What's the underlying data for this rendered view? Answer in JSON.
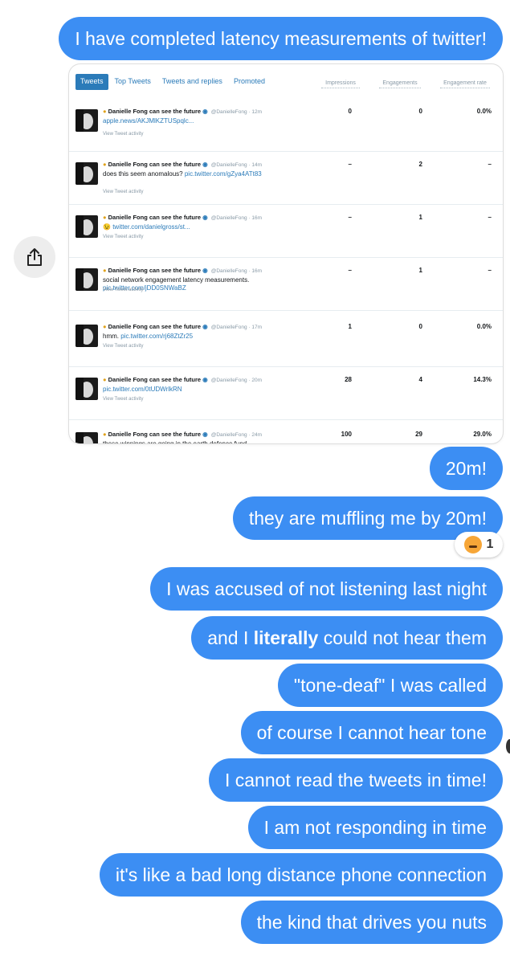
{
  "messages": [
    "I have completed latency measurements of twitter!",
    "20m!",
    "they are muffling me by 20m!",
    "I was accused of not listening last night",
    "\"tone-deaf\" I was called",
    "of course I cannot hear tone",
    "I cannot read the tweets in time!",
    "I am not responding in time",
    "it's like a bad long distance phone connection",
    "the kind that drives you nuts"
  ],
  "literally_message": {
    "before": "and I ",
    "bold": "literally",
    "after": " could not hear them"
  },
  "reaction": {
    "emoji": "angry-face-emoji",
    "count": "1"
  },
  "screenshot": {
    "tabs": [
      "Tweets",
      "Top Tweets",
      "Tweets and replies",
      "Promoted"
    ],
    "columns": [
      "Impressions",
      "Engagements",
      "Engagement rate"
    ],
    "view_activity": "View Tweet activity",
    "tweets": [
      {
        "name": "Danielle Fong can see the future",
        "handle": "@DanielleFong · 12m",
        "text": "",
        "link": "apple.news/AKJMlKZTUSpqlc...",
        "impressions": "0",
        "engagements": "0",
        "rate": "0.0%"
      },
      {
        "name": "Danielle Fong can see the future",
        "handle": "@DanielleFong · 14m",
        "text": "does this seem anomalous? ",
        "link": "pic.twitter.com/gZya4ATt83",
        "impressions": "–",
        "engagements": "2",
        "rate": "–"
      },
      {
        "name": "Danielle Fong can see the future",
        "handle": "@DanielleFong · 16m",
        "text": "😉 ",
        "link": "twitter.com/danielgross/st...",
        "impressions": "–",
        "engagements": "1",
        "rate": "–"
      },
      {
        "name": "Danielle Fong can see the future",
        "handle": "@DanielleFong · 16m",
        "text": "social network engagement latency measurements. ",
        "link": "pic.twitter.com/jDD0SNWaBZ",
        "impressions": "–",
        "engagements": "1",
        "rate": "–"
      },
      {
        "name": "Danielle Fong can see the future",
        "handle": "@DanielleFong · 17m",
        "text": "hmm. ",
        "link": "pic.twitter.com/rj68ZtZr25",
        "impressions": "1",
        "engagements": "0",
        "rate": "0.0%"
      },
      {
        "name": "Danielle Fong can see the future",
        "handle": "@DanielleFong · 20m",
        "text": "",
        "link": "pic.twitter.com/0tUDWrlkRN",
        "impressions": "28",
        "engagements": "4",
        "rate": "14.3%"
      },
      {
        "name": "Danielle Fong can see the future",
        "handle": "@DanielleFong · 24m",
        "text": "these winnings are going in the earth defence fund.",
        "link": "",
        "impressions": "100",
        "engagements": "29",
        "rate": "29.0%"
      }
    ]
  },
  "colors": {
    "bubble": "#3c8ef3",
    "link": "#2b7bb9"
  }
}
